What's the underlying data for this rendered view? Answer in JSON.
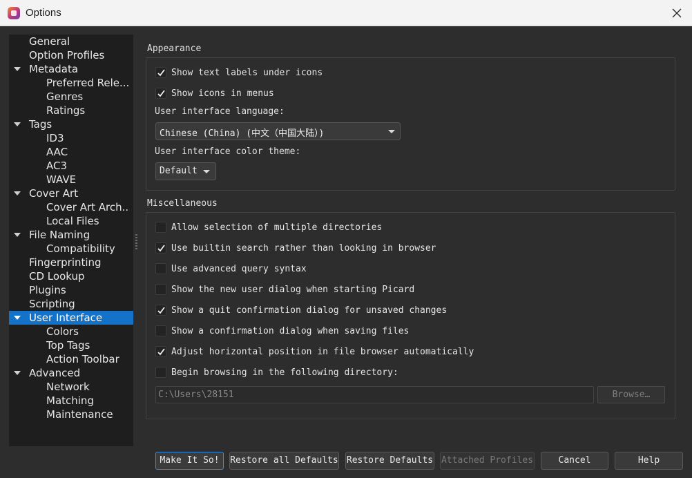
{
  "window": {
    "title": "Options"
  },
  "tree": [
    {
      "label": "General",
      "level": 1
    },
    {
      "label": "Option Profiles",
      "level": 1
    },
    {
      "label": "Metadata",
      "level": 1,
      "expanded": true
    },
    {
      "label": "Preferred Rele...",
      "level": 2
    },
    {
      "label": "Genres",
      "level": 2
    },
    {
      "label": "Ratings",
      "level": 2
    },
    {
      "label": "Tags",
      "level": 1,
      "expanded": true
    },
    {
      "label": "ID3",
      "level": 2
    },
    {
      "label": "AAC",
      "level": 2
    },
    {
      "label": "AC3",
      "level": 2
    },
    {
      "label": "WAVE",
      "level": 2
    },
    {
      "label": "Cover Art",
      "level": 1,
      "expanded": true
    },
    {
      "label": "Cover Art Arch...",
      "level": 2
    },
    {
      "label": "Local Files",
      "level": 2
    },
    {
      "label": "File Naming",
      "level": 1,
      "expanded": true
    },
    {
      "label": "Compatibility",
      "level": 2
    },
    {
      "label": "Fingerprinting",
      "level": 1
    },
    {
      "label": "CD Lookup",
      "level": 1
    },
    {
      "label": "Plugins",
      "level": 1
    },
    {
      "label": "Scripting",
      "level": 1
    },
    {
      "label": "User Interface",
      "level": 1,
      "expanded": true,
      "selected": true
    },
    {
      "label": "Colors",
      "level": 2
    },
    {
      "label": "Top Tags",
      "level": 2
    },
    {
      "label": "Action Toolbar",
      "level": 2
    },
    {
      "label": "Advanced",
      "level": 1,
      "expanded": true
    },
    {
      "label": "Network",
      "level": 2
    },
    {
      "label": "Matching",
      "level": 2
    },
    {
      "label": "Maintenance",
      "level": 2
    }
  ],
  "appearance": {
    "title": "Appearance",
    "show_text_labels": {
      "label": "Show text labels under icons",
      "checked": true
    },
    "show_icons_menus": {
      "label": "Show icons in menus",
      "checked": true
    },
    "language_label": "User interface language:",
    "language_value": "Chinese (China) (中文（中国大陆）)",
    "theme_label": "User interface color theme:",
    "theme_value": "Default"
  },
  "misc": {
    "title": "Miscellaneous",
    "items": [
      {
        "label": "Allow selection of multiple directories",
        "checked": false
      },
      {
        "label": "Use builtin search rather than looking in browser",
        "checked": true
      },
      {
        "label": "Use advanced query syntax",
        "checked": false
      },
      {
        "label": "Show the new user dialog when starting Picard",
        "checked": false
      },
      {
        "label": "Show a quit confirmation dialog for unsaved changes",
        "checked": true
      },
      {
        "label": "Show a confirmation dialog when saving files",
        "checked": false
      },
      {
        "label": "Adjust horizontal position in file browser automatically",
        "checked": true
      },
      {
        "label": "Begin browsing in the following directory:",
        "checked": false
      }
    ],
    "directory_value": "C:\\Users\\28151",
    "browse_label": "Browse…"
  },
  "buttons": {
    "make_it_so": "Make It So!",
    "restore_all": "Restore all Defaults",
    "restore_defaults": "Restore Defaults",
    "attached_profiles": "Attached Profiles",
    "cancel": "Cancel",
    "help": "Help"
  },
  "colors": {
    "selection": "#1473c8",
    "background": "#2d2d2d",
    "tree_bg": "#1e1e1e",
    "default_button_border": "#3b8de0"
  },
  "icons": {
    "app": "picard-logo-icon",
    "close": "close-icon",
    "checkmark": "checkmark-icon",
    "dropdown": "chevron-down-icon",
    "tree_expander": "triangle-down-icon"
  }
}
